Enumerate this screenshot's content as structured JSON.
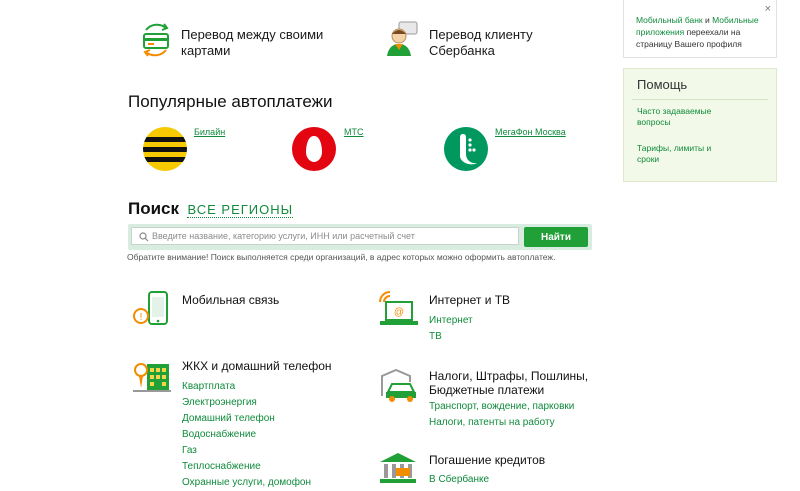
{
  "transfers": {
    "between_cards_line1": "Перевод между своими",
    "between_cards_line2": "картами",
    "to_client": "Перевод клиенту Сбербанка"
  },
  "autopay": {
    "title": "Популярные автоплатежи",
    "items": [
      {
        "label": "Билайн",
        "color": "#f7c900"
      },
      {
        "label": "МТС",
        "color": "#e30611"
      },
      {
        "label": "МегаФон Москва",
        "color": "#00985f"
      }
    ]
  },
  "search": {
    "title": "Поиск",
    "regions": "ВСЕ РЕГИОНЫ",
    "placeholder": "Введите название, категорию услуги, ИНН или расчетный счет",
    "button": "Найти",
    "note": "Обратите внимание! Поиск выполняется среди организаций, в адрес которых можно оформить автоплатеж."
  },
  "categories": {
    "mobile": {
      "title": "Мобильная связь"
    },
    "internet": {
      "title": "Интернет и ТВ",
      "items": [
        "Интернет",
        "ТВ"
      ]
    },
    "housing": {
      "title": "ЖКХ и домашний телефон",
      "items": [
        "Квартплата",
        "Электроэнергия",
        "Домашний телефон",
        "Водоснабжение",
        "Газ",
        "Теплоснабжение",
        "Охранные услуги, домофон"
      ]
    },
    "taxes": {
      "title_line1": "Налоги, Штрафы, Пошлины,",
      "title_line2": "Бюджетные платежи",
      "items": [
        "Транспорт, вождение, парковки",
        "Налоги, патенты на работу"
      ]
    },
    "loans": {
      "title": "Погашение кредитов",
      "items": [
        "В Сбербанке"
      ]
    }
  },
  "promo": {
    "link1": "Мобильный банк",
    "and": " и ",
    "link2": "Мобильные приложения",
    "rest": " переехали на страницу Вашего профиля",
    "close": "×"
  },
  "help": {
    "title": "Помощь",
    "faq_line1": "Часто задаваемые",
    "faq_line2": "вопросы",
    "tariffs_line1": "Тарифы, лимиты и",
    "tariffs_line2": "сроки"
  },
  "colors": {
    "accent": "#21a038",
    "link": "#108b3c",
    "help_bg": "#f2f9e8"
  }
}
